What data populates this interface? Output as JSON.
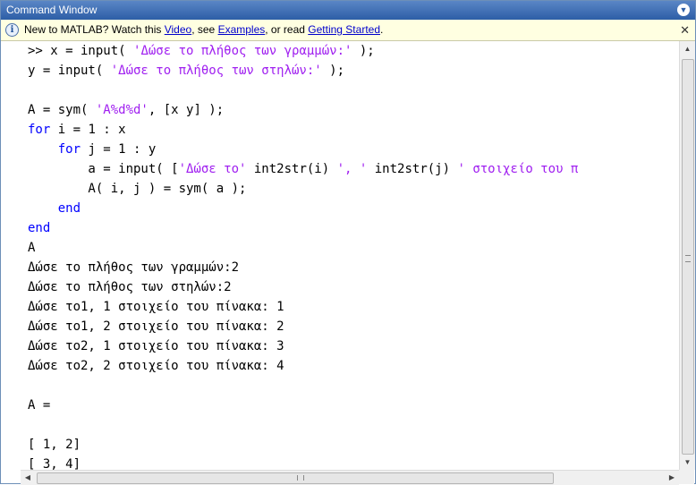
{
  "window": {
    "title": "Command Window"
  },
  "infobar": {
    "prefix": "New to MATLAB? Watch this ",
    "video_link": "Video",
    "sep1": ", see ",
    "examples_link": "Examples",
    "sep2": ", or read ",
    "getting_started_link": "Getting Started",
    "suffix": ".",
    "close_glyph": "✕"
  },
  "code": {
    "l1_prompt": ">> x = input( ",
    "l1_str": "'Δώσε το πλήθος των γραμμών:'",
    "l1_end": " );",
    "l2_start": "y = input( ",
    "l2_str": "'Δώσε το πλήθος των στηλών:'",
    "l2_end": " );",
    "l4_start": "A = sym( ",
    "l4_str": "'A%d%d'",
    "l4_end": ", [x y] );",
    "l5_kw": "for",
    "l5_rest": " i = 1 : x",
    "l6_indent": "    ",
    "l6_kw": "for",
    "l6_rest": " j = 1 : y",
    "l7_start": "        a = input( [",
    "l7_str1": "'Δώσε το'",
    "l7_mid1": " int2str(i) ",
    "l7_str2": "', '",
    "l7_mid2": " int2str(j) ",
    "l7_str3": "' στοιχείο του π",
    "l8": "        A( i, j ) = sym( a );",
    "l9_indent": "    ",
    "l9_kw": "end",
    "l10_kw": "end",
    "l11": "A",
    "out1": "Δώσε το πλήθος των γραμμών:2",
    "out2": "Δώσε το πλήθος των στηλών:2",
    "out3": "Δώσε το1, 1 στοιχείο του πίνακα: 1",
    "out4": "Δώσε το1, 2 στοιχείο του πίνακα: 2",
    "out5": "Δώσε το2, 1 στοιχείο του πίνακα: 3",
    "out6": "Δώσε το2, 2 στοιχείο του πίνακα: 4",
    "result_label": "A =",
    "row1": "[ 1, 2]",
    "row2": "[ 3, 4]"
  },
  "icons": {
    "window_menu": "▼",
    "info": "i",
    "fx": "fx",
    "scroll_up": "▲",
    "scroll_down": "▼",
    "scroll_left": "◀",
    "scroll_right": "▶"
  },
  "colors": {
    "keyword": "#0000ff",
    "string": "#a020f0",
    "titlebar": "#2d5ea6",
    "infobar_bg": "#ffffe1"
  }
}
